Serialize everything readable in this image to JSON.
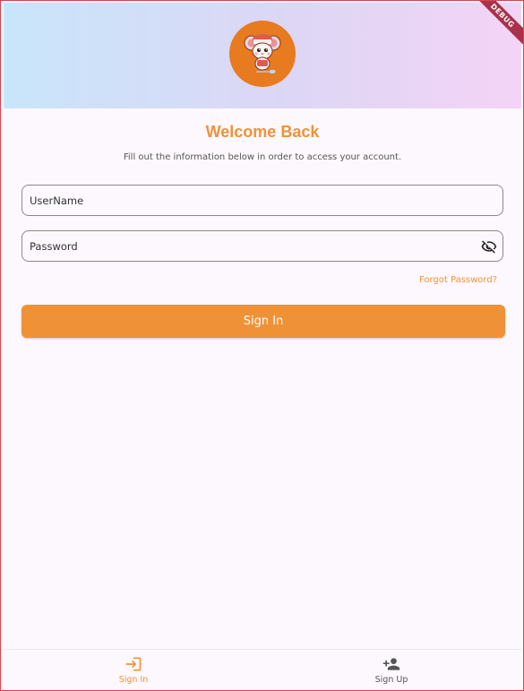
{
  "header": {
    "debug_badge": "DEBUG",
    "logo_icon": "mouse-chef-mascot"
  },
  "main": {
    "title": "Welcome Back",
    "subtitle": "Fill out the information below in order to access your account.",
    "username": {
      "placeholder": "UserName",
      "value": ""
    },
    "password": {
      "placeholder": "Password",
      "value": "",
      "toggle_icon": "visibility-off-icon"
    },
    "forgot_link": "Forgot Password?",
    "signin_button": "Sign In"
  },
  "bottom_nav": {
    "items": [
      {
        "label": "Sign In",
        "icon": "login-icon",
        "active": true
      },
      {
        "label": "Sign Up",
        "icon": "person-add-icon",
        "active": false
      }
    ]
  },
  "colors": {
    "accent": "#ef9237",
    "header_gradient_start": "#c8e6fb",
    "header_gradient_end": "#f4d4f6",
    "background": "#fdf8fd"
  }
}
